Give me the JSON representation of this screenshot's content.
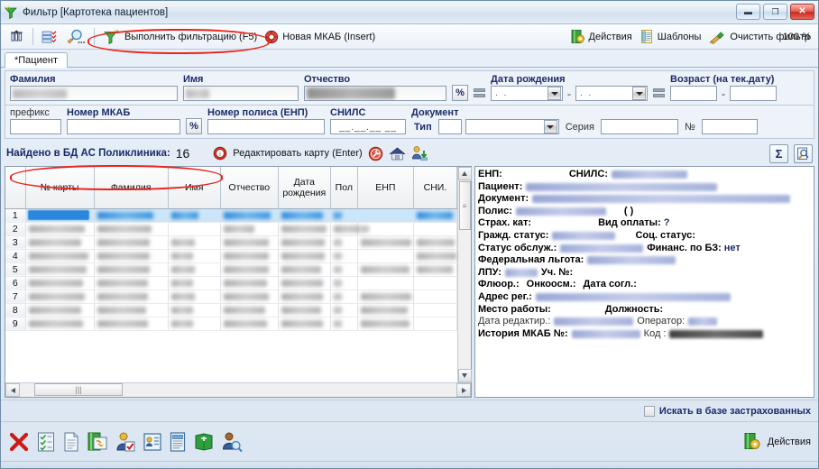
{
  "window": {
    "title": "Фильтр [Картотека пациентов]",
    "icon": "filter-funnel-icon",
    "minimize_label": "—",
    "maximize_label": "❐",
    "close_label": "✕"
  },
  "toolbar": {
    "icons": [
      {
        "name": "columns-chart-icon"
      },
      {
        "name": "list-settings-icon"
      },
      {
        "name": "search-edit-icon"
      }
    ],
    "run_filter_label": "Выполнить фильтрацию (F5)",
    "new_mkab_label": "Новая МКАБ (Insert)",
    "actions_label": "Действия",
    "templates_label": "Шаблоны",
    "clear_filter_label": "Очистить фильтр",
    "zoom_label": "100 %"
  },
  "tabs": [
    {
      "label": "*Пациент",
      "active": true
    }
  ],
  "filter": {
    "surname": {
      "label": "Фамилия",
      "value": ""
    },
    "name": {
      "label": "Имя",
      "value": ""
    },
    "patronymic": {
      "label": "Отчество",
      "value": ""
    },
    "percent_button": "%",
    "prefix": {
      "label": "префикс",
      "value": ""
    },
    "mkab_number": {
      "label": "Номер МКАБ",
      "value": ""
    },
    "policy_number": {
      "label": "Номер полиса (ЕНП)",
      "value": ""
    },
    "snils": {
      "label": "СНИЛС",
      "value": "__.__.__ __"
    },
    "birthdate": {
      "label": "Дата рождения",
      "from": " .  . ",
      "to": " .  . ",
      "separator": "-"
    },
    "age": {
      "label": "Возраст (на тек.дату)",
      "from": "",
      "to": "",
      "separator": "-"
    },
    "document": {
      "label": "Документ",
      "type_label": "Тип",
      "type_value": "",
      "series_label": "Серия",
      "series_value": "",
      "number_label": "№",
      "number_value": ""
    }
  },
  "results": {
    "found_label": "Найдено в БД АС Поликлиника:",
    "found_count": "16",
    "info_icon": "info-circle-icon",
    "edit_card_label": "Редактировать карту (Enter)",
    "wrench_icon": "wrench-circle-icon",
    "home_icon": "home-icon",
    "user_import_icon": "user-import-icon",
    "sum_button": "Σ",
    "search_doc_icon": "document-search-icon"
  },
  "grid": {
    "columns": [
      "№ карты",
      "Фамилия",
      "Имя",
      "Отчество",
      "Дата рождения",
      "Пол",
      "ЕНП",
      "СНИ."
    ],
    "rows": [
      {
        "num": "1",
        "selected": true
      },
      {
        "num": "2",
        "selected": false
      },
      {
        "num": "3",
        "selected": false
      },
      {
        "num": "4",
        "selected": false
      },
      {
        "num": "5",
        "selected": false
      },
      {
        "num": "6",
        "selected": false
      },
      {
        "num": "7",
        "selected": false
      },
      {
        "num": "8",
        "selected": false
      },
      {
        "num": "9",
        "selected": false
      }
    ]
  },
  "detail": {
    "enp_label": "ЕНП:",
    "snils_label": "СНИЛС:",
    "patient_label": "Пациент:",
    "document_label": "Документ:",
    "policy_label": "Полис:",
    "policy_paren": "( )",
    "insurance_cat_label": "Страх. кат:",
    "payment_type_label": "Вид оплаты:",
    "payment_type_value": "?",
    "citizen_status_label": "Гражд. статус:",
    "social_status_label": "Соц. статус:",
    "service_status_label": "Статус обслуж.:",
    "finance_bz_label": "Финанс. по БЗ:",
    "finance_bz_value": "нет",
    "federal_benefit_label": "Федеральная льгота:",
    "lpu_label": "ЛПУ:",
    "uch_label": "Уч. №:",
    "fluor_label": "Флюор.:",
    "oncoexam_label": "Онкоосм.:",
    "agreement_date_label": "Дата согл.:",
    "reg_address_label": "Адрес рег.:",
    "workplace_label": "Место работы:",
    "position_label": "Должность:",
    "edit_date_label": "Дата редактир.:",
    "operator_label": "Оператор:",
    "mkab_history_label": "История МКАБ №:",
    "code_label": "Код :"
  },
  "footer": {
    "insured_checkbox_label": "Искать в базе застрахованных",
    "insured_checked": false,
    "icons": [
      {
        "name": "delete-red-x-icon"
      },
      {
        "name": "checklist-icon"
      },
      {
        "name": "document-icon"
      },
      {
        "name": "link-document-icon"
      },
      {
        "name": "user-check-icon"
      },
      {
        "name": "id-card-icon"
      },
      {
        "name": "card-list-icon"
      },
      {
        "name": "green-book-icon"
      },
      {
        "name": "user-search-icon"
      }
    ],
    "actions_label": "Действия",
    "actions_icon": "actions-gear-icon"
  },
  "colors": {
    "accent_blue": "#1b2a6b",
    "selection_blue": "#cbe6fb",
    "annotation_red": "#e8241c",
    "close_red": "#c8271c"
  }
}
